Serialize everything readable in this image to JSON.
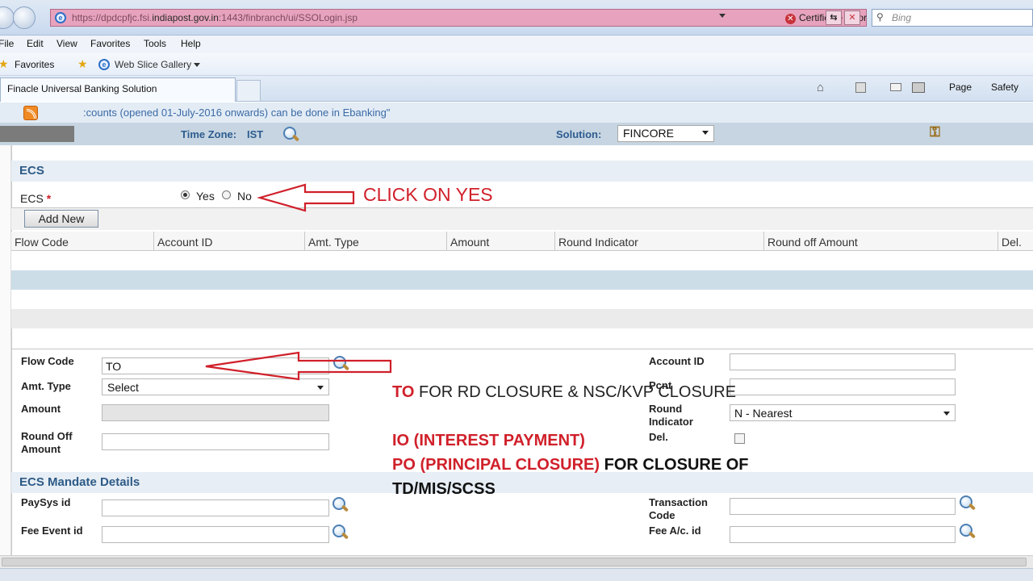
{
  "browser": {
    "url_prefix": "https://dpdcpfjc.fsi.",
    "url_domain": "indiapost.gov.in",
    "url_suffix": ":1443/finbranch/ui/SSOLogin.jsp",
    "certificate_error": "Certificate Error",
    "search_placeholder": "Bing",
    "menu": [
      "File",
      "Edit",
      "View",
      "Favorites",
      "Tools",
      "Help"
    ],
    "favorites_label": "Favorites",
    "web_slice_gallery": "Web Slice Gallery",
    "tab_title": "Finacle Universal Banking Solution",
    "toolbar_page": "Page",
    "toolbar_safety": "Safety"
  },
  "app": {
    "ticker_text": ":counts (opened 01-July-2016 onwards) can be done in Ebanking\"",
    "time_zone_label": "Time Zone:",
    "time_zone_value": "IST",
    "solution_label": "Solution:",
    "solution_value": "FINCORE"
  },
  "ecs": {
    "section_title": "ECS",
    "ecs_label": "ECS",
    "required_mark": "*",
    "yes_label": "Yes",
    "no_label": "No",
    "selected": "Yes",
    "add_new_label": "Add New",
    "table_headers": [
      "Flow Code",
      "Account ID",
      "Amt. Type",
      "Amount",
      "Round Indicator",
      "Round off Amount",
      "Del."
    ]
  },
  "form": {
    "flow_code_label": "Flow Code",
    "flow_code_value": "TO",
    "amt_type_label": "Amt. Type",
    "amt_type_value": "Select",
    "amount_label": "Amount",
    "round_off_label_1": "Round Off",
    "round_off_label_2": "Amount",
    "account_id_label": "Account ID",
    "pcnt_label": "Pcnt",
    "round_indicator_label_1": "Round",
    "round_indicator_label_2": "Indicator",
    "round_indicator_value": "N - Nearest",
    "del_label": "Del."
  },
  "mandate": {
    "section_title": "ECS Mandate Details",
    "paysys_label": "PaySys id",
    "fee_event_label": "Fee Event id",
    "txn_code_label_1": "Transaction",
    "txn_code_label_2": "Code",
    "fee_ac_label": "Fee A/c. id"
  },
  "annotations": {
    "click_on_yes": "CLICK ON YES",
    "to_code": "TO",
    "to_desc": "FOR RD CLOSURE & NSC/KVP CLOSURE",
    "io_line": "IO (INTEREST PAYMENT)",
    "po_line": "PO (PRINCIPAL CLOSURE)",
    "po_desc": "FOR CLOSURE OF",
    "td_line": "TD/MIS/SCSS",
    "accent_red": "#d0202a"
  }
}
